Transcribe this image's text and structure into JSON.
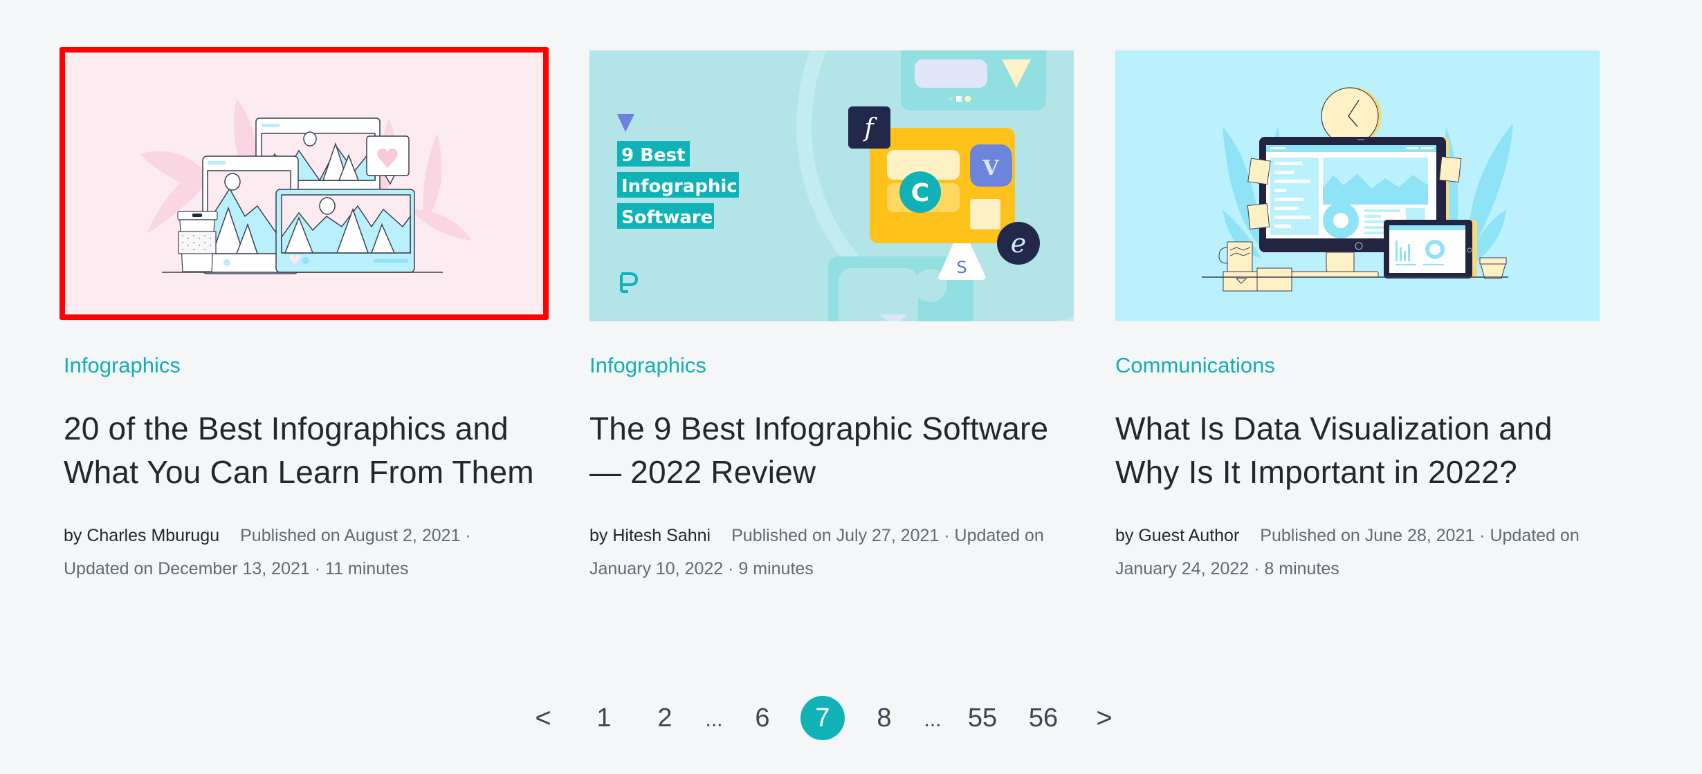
{
  "articles": [
    {
      "category": "Infographics",
      "title": "20 of the Best Infographics and What You Can Learn From Them",
      "author": "by Charles Mburugu",
      "dates": "Published on August 2, 2021 · Updated on December 13, 2021 · 11 minutes",
      "image": {
        "description": "devices with mountain photos illustration",
        "bg": "#fdebf2"
      },
      "highlighted": true
    },
    {
      "category": "Infographics",
      "title": "The 9 Best Infographic Software — 2022 Review",
      "author": "by Hitesh Sahni",
      "dates": "Published on July 27, 2021 · Updated on January 10, 2022 · 9 minutes",
      "image": {
        "description": "software logos illustration",
        "bg": "#b3e5e8",
        "overlay_lines": [
          "9 Best",
          "Infographic",
          "Software"
        ],
        "logo_letters": {
          "f": "f",
          "v": "V",
          "c": "C",
          "e": "e",
          "s": "S"
        }
      },
      "highlighted": false
    },
    {
      "category": "Communications",
      "title": "What Is Data Visualization and Why Is It Important in 2022?",
      "author": "by Guest Author",
      "dates": "Published on June 28, 2021 · Updated on January 24, 2022 · 8 minutes",
      "image": {
        "description": "desktop monitor with dashboard illustration",
        "bg": "#bbf1fc"
      },
      "highlighted": false
    }
  ],
  "pagination": {
    "prev": "<",
    "next": ">",
    "items": [
      "1",
      "2",
      "...",
      "6",
      "7",
      "8",
      "...",
      "55",
      "56"
    ],
    "current": "7"
  },
  "colors": {
    "accent": "#10b2b8",
    "highlight_border": "#ff0000",
    "background": "#f5f6f8"
  }
}
